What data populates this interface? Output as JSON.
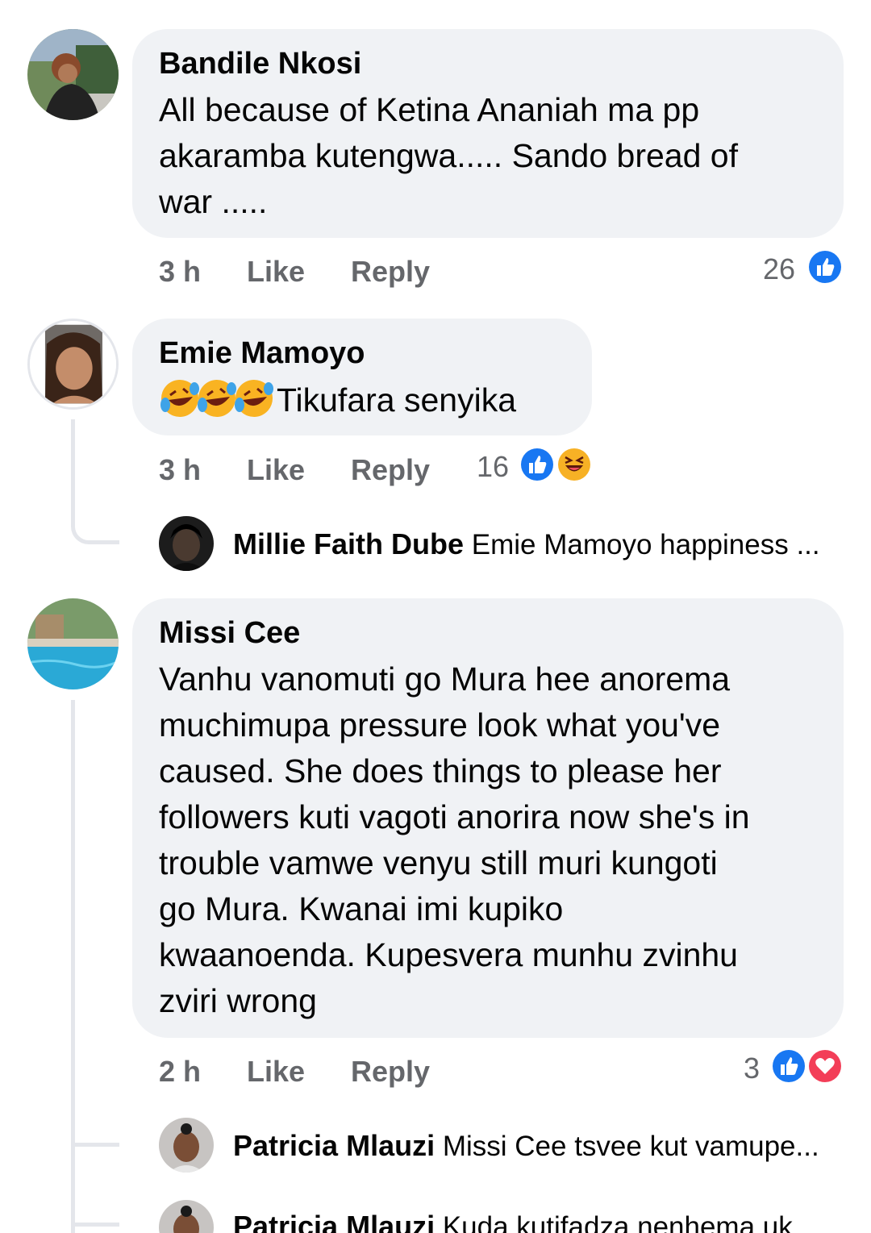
{
  "comments": [
    {
      "author": "Bandile Nkosi",
      "lines": [
        "All because of  Ketina Ananiah ma pp",
        "akaramba kutengwa..... Sando bread of",
        "war ....."
      ],
      "time": "3 h",
      "like_label": "Like",
      "reply_label": "Reply",
      "reaction_count": "26",
      "reactions": [
        "like-icon"
      ]
    },
    {
      "author": "Emie Mamoyo",
      "emojis": [
        "rolling-on-floor-laughing-emoji",
        "rolling-on-floor-laughing-emoji",
        "rolling-on-floor-laughing-emoji"
      ],
      "text": "Tikufara senyika",
      "time": "3 h",
      "like_label": "Like",
      "reply_label": "Reply",
      "reaction_count": "16",
      "reactions": [
        "like-icon",
        "haha-icon"
      ],
      "replies": [
        {
          "author": "Millie Faith Dube",
          "text": "Emie Mamoyo happiness ..."
        }
      ]
    },
    {
      "author": "Missi Cee",
      "lines": [
        "Vanhu vanomuti go Mura hee anorema",
        "muchimupa pressure look what you've",
        "caused. She does things to please her",
        "followers kuti vagoti anorira now she's in",
        "trouble vamwe venyu still muri kungoti",
        "go Mura. Kwanai imi kupiko",
        "kwaanoenda. Kupesvera munhu zvinhu",
        "zviri wrong"
      ],
      "time": "2 h",
      "like_label": "Like",
      "reply_label": "Reply",
      "reaction_count": "3",
      "reactions": [
        "like-icon",
        "love-icon"
      ],
      "replies": [
        {
          "author": "Patricia Mlauzi",
          "text": "Missi Cee tsvee kut vamupe..."
        },
        {
          "author": "Patricia Mlauzi",
          "text": "Kuda kutifadza nenhema uk"
        }
      ]
    }
  ],
  "colors": {
    "bubble": "#f0f2f5",
    "meta": "#65676b",
    "like_blue": "#1877f2",
    "love_red": "#f33e58",
    "haha_yellow": "#f7b125"
  }
}
